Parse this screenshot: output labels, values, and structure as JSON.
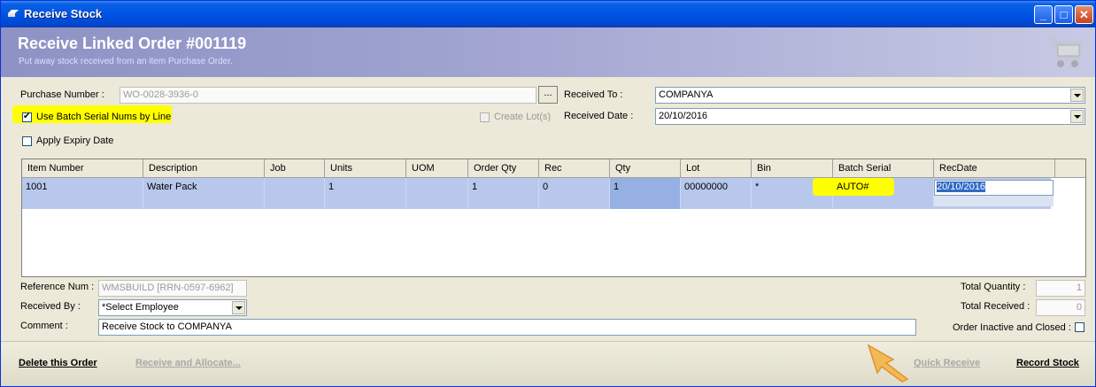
{
  "window": {
    "title": "Receive Stock",
    "minimize_glyph": "_",
    "maximize_glyph": "□",
    "close_glyph": "✕"
  },
  "header": {
    "title": "Receive Linked Order #001119",
    "subtitle": "Put away stock received from an item Purchase Order.",
    "icon": "shopping-cart-icon"
  },
  "form": {
    "purchase_number_label": "Purchase Number :",
    "purchase_number_value": "WO-0028-3936-0",
    "browse_label": "...",
    "use_batch_label": "Use Batch Serial Nums by Line",
    "use_batch_checked": true,
    "create_lots_label": "Create Lot(s)",
    "create_lots_checked": false,
    "apply_expiry_label": "Apply Expiry Date",
    "apply_expiry_checked": false,
    "received_to_label": "Received To :",
    "received_to_value": "COMPANYA",
    "received_date_label": "Received Date :",
    "received_date_value": "20/10/2016"
  },
  "grid": {
    "columns": [
      "Item Number",
      "Description",
      "Job",
      "Units",
      "UOM",
      "Order Qty",
      "Rec",
      "Qty",
      "Lot",
      "Bin",
      "Batch Serial",
      "RecDate"
    ],
    "rows": [
      {
        "item_number": "1001",
        "description": "Water Pack",
        "job": "",
        "units": "1",
        "uom": "",
        "order_qty": "1",
        "rec": "0",
        "qty": "1",
        "lot": "00000000",
        "bin": "*",
        "batch_serial": "AUTO#",
        "rec_date": "20/10/2016"
      }
    ]
  },
  "bottom": {
    "reference_num_label": "Reference Num :",
    "reference_num_value": "WMSBUILD [RRN-0597-6962]",
    "received_by_label": "Received By :",
    "received_by_value": "*Select Employee",
    "comment_label": "Comment :",
    "comment_value": "Receive Stock to COMPANYA",
    "total_quantity_label": "Total Quantity :",
    "total_quantity_value": "1",
    "total_received_label": "Total Received :",
    "total_received_value": "0",
    "order_inactive_label": "Order Inactive and Closed :",
    "order_inactive_checked": false
  },
  "footer": {
    "delete_label": "Delete this Order",
    "receive_allocate_label": "Receive and Allocate...",
    "quick_receive_label": "Quick Receive",
    "record_stock_label": "Record Stock"
  },
  "colors": {
    "titlebar": "#0055e5",
    "header": "#9ea2cf",
    "row_selected": "#b8c8ec",
    "highlight": "#ffff00",
    "arrow": "#f5a623"
  }
}
